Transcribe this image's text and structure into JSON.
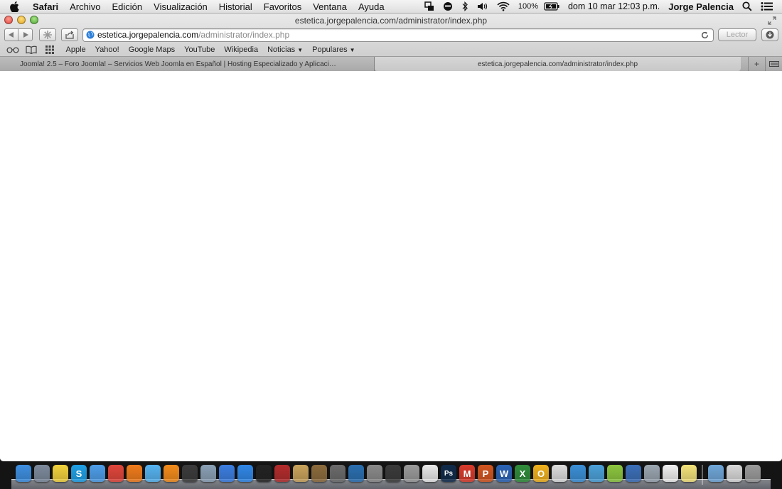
{
  "menubar": {
    "app": "Safari",
    "items": [
      "Archivo",
      "Edición",
      "Visualización",
      "Historial",
      "Favoritos",
      "Ventana",
      "Ayuda"
    ],
    "battery": "100%",
    "clock": "dom 10 mar  12:03 p.m.",
    "user": "Jorge Palencia"
  },
  "window": {
    "title": "estetica.jorgepalencia.com/administrator/index.php"
  },
  "address": {
    "host": "estetica.jorgepalencia.com",
    "path": "/administrator/index.php",
    "reader": "Lector"
  },
  "bookmarks": {
    "items": [
      "Apple",
      "Yahoo!",
      "Google Maps",
      "YouTube",
      "Wikipedia"
    ],
    "folders": [
      "Noticias",
      "Populares"
    ]
  },
  "tabs": [
    {
      "title": "Joomla! 2.5 – Foro Joomla! – Servicios Web Joomla en Español | Hosting Especializado y Aplicaci…",
      "active": false
    },
    {
      "title": "estetica.jorgepalencia.com/administrator/index.php",
      "active": true
    }
  ],
  "dock": {
    "icons": [
      {
        "name": "finder",
        "color": "#3d8ee0",
        "glyph": ""
      },
      {
        "name": "launchpad",
        "color": "#7d8a9c",
        "glyph": ""
      },
      {
        "name": "stickies",
        "color": "#f2d23c",
        "glyph": ""
      },
      {
        "name": "skype",
        "color": "#1ea0e6",
        "glyph": "S"
      },
      {
        "name": "safari",
        "color": "#4d9de8",
        "glyph": ""
      },
      {
        "name": "chrome",
        "color": "#e0453a",
        "glyph": ""
      },
      {
        "name": "firefox",
        "color": "#f07b1b",
        "glyph": ""
      },
      {
        "name": "messages",
        "color": "#55b2f0",
        "glyph": ""
      },
      {
        "name": "vlc",
        "color": "#f38b1a",
        "glyph": ""
      },
      {
        "name": "facetime",
        "color": "#3b3b3b",
        "glyph": ""
      },
      {
        "name": "preview",
        "color": "#8aa0b5",
        "glyph": ""
      },
      {
        "name": "itunes",
        "color": "#3b7de0",
        "glyph": ""
      },
      {
        "name": "app-store",
        "color": "#2f86e6",
        "glyph": ""
      },
      {
        "name": "blackberry",
        "color": "#222222",
        "glyph": ""
      },
      {
        "name": "photo-booth",
        "color": "#b32b2b",
        "glyph": ""
      },
      {
        "name": "contacts",
        "color": "#c9a35b",
        "glyph": ""
      },
      {
        "name": "iphoto",
        "color": "#8c6b3c",
        "glyph": ""
      },
      {
        "name": "imovie",
        "color": "#6b6b6b",
        "glyph": ""
      },
      {
        "name": "quicktime",
        "color": "#2a6fb0",
        "glyph": ""
      },
      {
        "name": "system-preferences",
        "color": "#8a8a8a",
        "glyph": ""
      },
      {
        "name": "activity-monitor",
        "color": "#3a3a3a",
        "glyph": ""
      },
      {
        "name": "disk-utility",
        "color": "#9a9a9a",
        "glyph": ""
      },
      {
        "name": "acrobat",
        "color": "#e8e8e8",
        "glyph": ""
      },
      {
        "name": "photoshop",
        "color": "#0f2a4a",
        "glyph": "Ps"
      },
      {
        "name": "mindjet",
        "color": "#d83a2a",
        "glyph": "M"
      },
      {
        "name": "powerpoint",
        "color": "#d2551f",
        "glyph": "P"
      },
      {
        "name": "word",
        "color": "#2b63b5",
        "glyph": "W"
      },
      {
        "name": "excel",
        "color": "#2f8d3a",
        "glyph": "X"
      },
      {
        "name": "outlook",
        "color": "#f0b11c",
        "glyph": "O"
      },
      {
        "name": "textedit",
        "color": "#dcdcdc",
        "glyph": ""
      },
      {
        "name": "sync",
        "color": "#3a8fd6",
        "glyph": ""
      },
      {
        "name": "network-utility",
        "color": "#4aa0d8",
        "glyph": ""
      },
      {
        "name": "movistar",
        "color": "#8cc63e",
        "glyph": ""
      },
      {
        "name": "remote-desktop",
        "color": "#3b6fb8",
        "glyph": ""
      },
      {
        "name": "screenshot",
        "color": "#9aa5b0",
        "glyph": ""
      },
      {
        "name": "notes",
        "color": "#efefef",
        "glyph": ""
      },
      {
        "name": "notepad",
        "color": "#f3e27a",
        "glyph": ""
      }
    ],
    "right": [
      {
        "name": "applications-folder",
        "color": "#6fa6d8",
        "glyph": ""
      },
      {
        "name": "documents-stack",
        "color": "#d8d8d8",
        "glyph": ""
      },
      {
        "name": "trash",
        "color": "#9a9a9a",
        "glyph": ""
      }
    ]
  }
}
